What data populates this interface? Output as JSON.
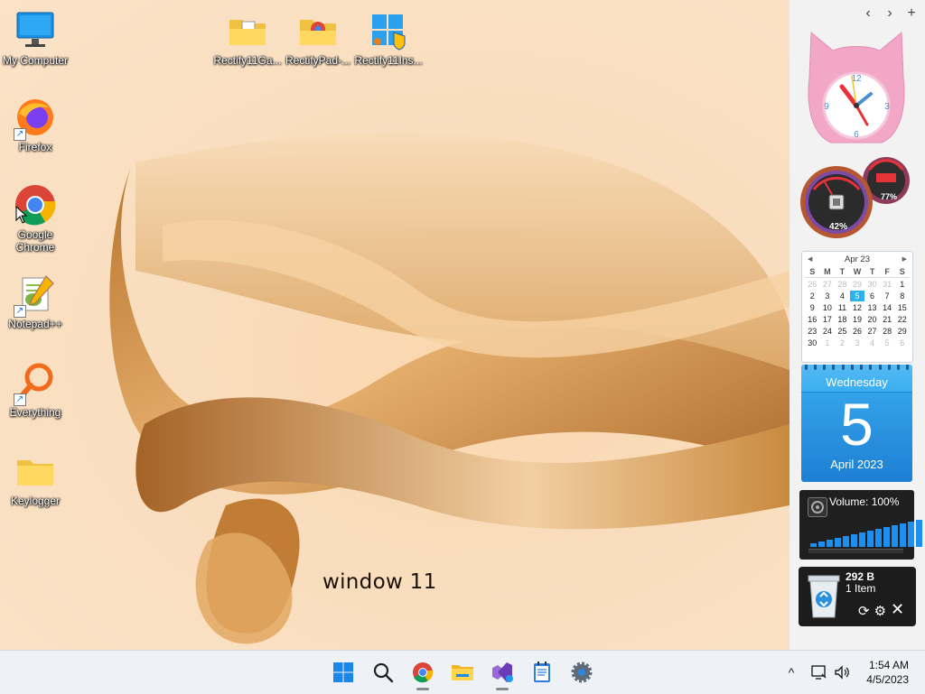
{
  "desktop": {
    "wallpaper_text": "window 11",
    "icons": [
      {
        "label": "My Computer",
        "icon": "monitor-icon"
      },
      {
        "label": "Firefox",
        "icon": "firefox-icon"
      },
      {
        "label": "Google Chrome",
        "icon": "chrome-icon"
      },
      {
        "label": "Notepad++",
        "icon": "notepadpp-icon"
      },
      {
        "label": "Everything",
        "icon": "search-magnifier-icon"
      },
      {
        "label": "Keylogger",
        "icon": "folder-icon"
      },
      {
        "label": "Rectify11Ga...",
        "icon": "folder-icon"
      },
      {
        "label": "RectifyPad-...",
        "icon": "chrome-folder-icon"
      },
      {
        "label": "Rectify11Ins...",
        "icon": "installer-icon"
      }
    ]
  },
  "sidebar": {
    "nav": {
      "back": "‹",
      "forward": "›",
      "add": "+"
    },
    "clock_numbers": {
      "n12": "12",
      "n3": "3",
      "n6": "6",
      "n9": "9"
    },
    "gauges": {
      "cpu": "42%",
      "ram": "77%"
    },
    "calendar": {
      "month_label": "Apr 23",
      "prev": "◀",
      "next": "▶",
      "weekdays": [
        "S",
        "M",
        "T",
        "W",
        "T",
        "F",
        "S"
      ],
      "weeks": [
        [
          "26",
          "27",
          "28",
          "29",
          "30",
          "31",
          "1"
        ],
        [
          "2",
          "3",
          "4",
          "5",
          "6",
          "7",
          "8"
        ],
        [
          "9",
          "10",
          "11",
          "12",
          "13",
          "14",
          "15"
        ],
        [
          "16",
          "17",
          "18",
          "19",
          "20",
          "21",
          "22"
        ],
        [
          "23",
          "24",
          "25",
          "26",
          "27",
          "28",
          "29"
        ],
        [
          "30",
          "1",
          "2",
          "3",
          "4",
          "5",
          "6"
        ]
      ],
      "today": "5"
    },
    "day": {
      "weekday": "Wednesday",
      "date": "5",
      "month_year": "April 2023"
    },
    "volume": {
      "label": "Volume: 100%",
      "level": 1.0
    },
    "recycle_bin": {
      "size": "292 B",
      "items": "1 Item"
    }
  },
  "taskbar": {
    "apps": [
      {
        "name": "start",
        "icon": "windows-start-icon"
      },
      {
        "name": "search",
        "icon": "search-icon"
      },
      {
        "name": "chrome",
        "icon": "chrome-icon"
      },
      {
        "name": "file-explorer",
        "icon": "folder-icon"
      },
      {
        "name": "visual-studio",
        "icon": "visual-studio-icon"
      },
      {
        "name": "notepad",
        "icon": "notepad-icon"
      },
      {
        "name": "settings",
        "icon": "gear-icon"
      }
    ],
    "tray": {
      "chevron": "^"
    },
    "clock": {
      "time": "1:54 AM",
      "date": "4/5/2023"
    }
  },
  "colors": {
    "accent": "#1c8ff0",
    "wallpaper": "#f9ddbd",
    "wave": "#c98a3e"
  }
}
